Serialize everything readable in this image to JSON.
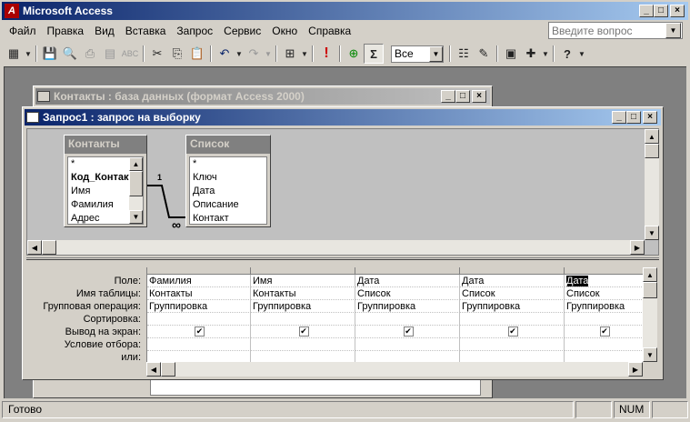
{
  "app": {
    "title": "Microsoft Access"
  },
  "menu": [
    "Файл",
    "Правка",
    "Вид",
    "Вставка",
    "Запрос",
    "Сервис",
    "Окно",
    "Справка"
  ],
  "help_box": {
    "placeholder": "Введите вопрос"
  },
  "toolbar": {
    "query_type_glyph": "Σ",
    "top_values": "Все"
  },
  "db_window": {
    "title": "Контакты : база данных (формат Access 2000)"
  },
  "query_window": {
    "title": "Запрос1 : запрос на выборку"
  },
  "tables": [
    {
      "name": "Контакты",
      "fields": [
        "*",
        "Код_Контакт",
        "Имя",
        "Фамилия",
        "Адрес"
      ]
    },
    {
      "name": "Список",
      "fields": [
        "*",
        "Ключ",
        "Дата",
        "Описание",
        "Контакт"
      ]
    }
  ],
  "relation": {
    "one": "1",
    "many": "∞"
  },
  "grid": {
    "row_labels": [
      "Поле:",
      "Имя таблицы:",
      "Групповая операция:",
      "Сортировка:",
      "Вывод на экран:",
      "Условие отбора:",
      "или:"
    ],
    "columns": [
      {
        "field": "Фамилия",
        "table": "Контакты",
        "total": "Группировка",
        "sort": "",
        "show": true,
        "criteria": "",
        "or": ""
      },
      {
        "field": "Имя",
        "table": "Контакты",
        "total": "Группировка",
        "sort": "",
        "show": true,
        "criteria": "",
        "or": ""
      },
      {
        "field": "Дата",
        "table": "Список",
        "total": "Группировка",
        "sort": "",
        "show": true,
        "criteria": "",
        "or": ""
      },
      {
        "field": "Дата",
        "table": "Список",
        "total": "Группировка",
        "sort": "",
        "show": true,
        "criteria": "",
        "or": ""
      },
      {
        "field": "Дата",
        "table": "Список",
        "total": "Группировка",
        "sort": "",
        "show": true,
        "criteria": "",
        "or": ""
      }
    ]
  },
  "status": {
    "left": "Готово",
    "num": "NUM"
  },
  "colors": {
    "title_active": "#0a246a",
    "title_gradient_end": "#a6caf0",
    "face": "#d4d0c8",
    "workspace": "#808080"
  }
}
